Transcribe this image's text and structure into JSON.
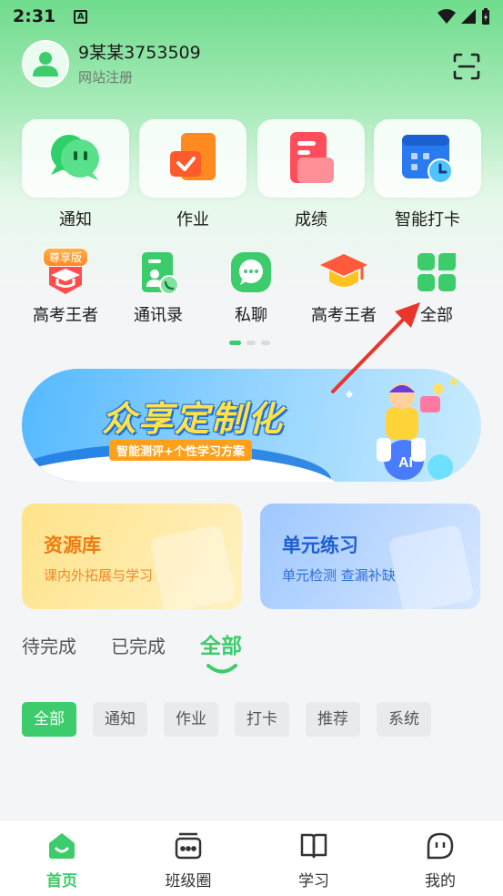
{
  "status_bar": {
    "time": "2:31",
    "notif_letter": "A"
  },
  "profile": {
    "name": "9某某3753509",
    "subtitle": "网站注册"
  },
  "main_features": [
    {
      "label": "通知",
      "icon": "chat-bubble-icon"
    },
    {
      "label": "作业",
      "icon": "homework-icon"
    },
    {
      "label": "成绩",
      "icon": "score-document-icon"
    },
    {
      "label": "智能打卡",
      "icon": "calendar-clock-icon"
    }
  ],
  "quick_features": [
    {
      "label": "高考王者",
      "icon": "graduation-cap-icon",
      "badge": "尊享版"
    },
    {
      "label": "通讯录",
      "icon": "contacts-icon"
    },
    {
      "label": "私聊",
      "icon": "private-chat-icon"
    },
    {
      "label": "高考王者",
      "icon": "graduation-cap-icon"
    },
    {
      "label": "全部",
      "icon": "all-grid-icon"
    }
  ],
  "pager": {
    "pages": 3,
    "active": 0
  },
  "banner": {
    "title": "众享定制化",
    "subtitle": "智能测评+个性学习方案"
  },
  "cards": {
    "resources": {
      "title": "资源库",
      "subtitle": "课内外拓展与学习"
    },
    "unit_practice": {
      "title": "单元练习",
      "subtitle": "单元检测  查漏补缺"
    }
  },
  "status_tabs": [
    {
      "label": "待完成",
      "active": false
    },
    {
      "label": "已完成",
      "active": false
    },
    {
      "label": "全部",
      "active": true
    }
  ],
  "filter_chips": [
    {
      "label": "全部",
      "active": true
    },
    {
      "label": "通知",
      "active": false
    },
    {
      "label": "作业",
      "active": false
    },
    {
      "label": "打卡",
      "active": false
    },
    {
      "label": "推荐",
      "active": false
    },
    {
      "label": "系统",
      "active": false
    }
  ],
  "bottom_nav": [
    {
      "label": "首页",
      "icon": "home-icon",
      "active": true
    },
    {
      "label": "班级圈",
      "icon": "class-circle-icon",
      "active": false
    },
    {
      "label": "学习",
      "icon": "book-icon",
      "active": false
    },
    {
      "label": "我的",
      "icon": "profile-face-icon",
      "active": false
    }
  ],
  "colors": {
    "primary_green": "#3ccc6b",
    "annotation_arrow": "#e8362d"
  }
}
